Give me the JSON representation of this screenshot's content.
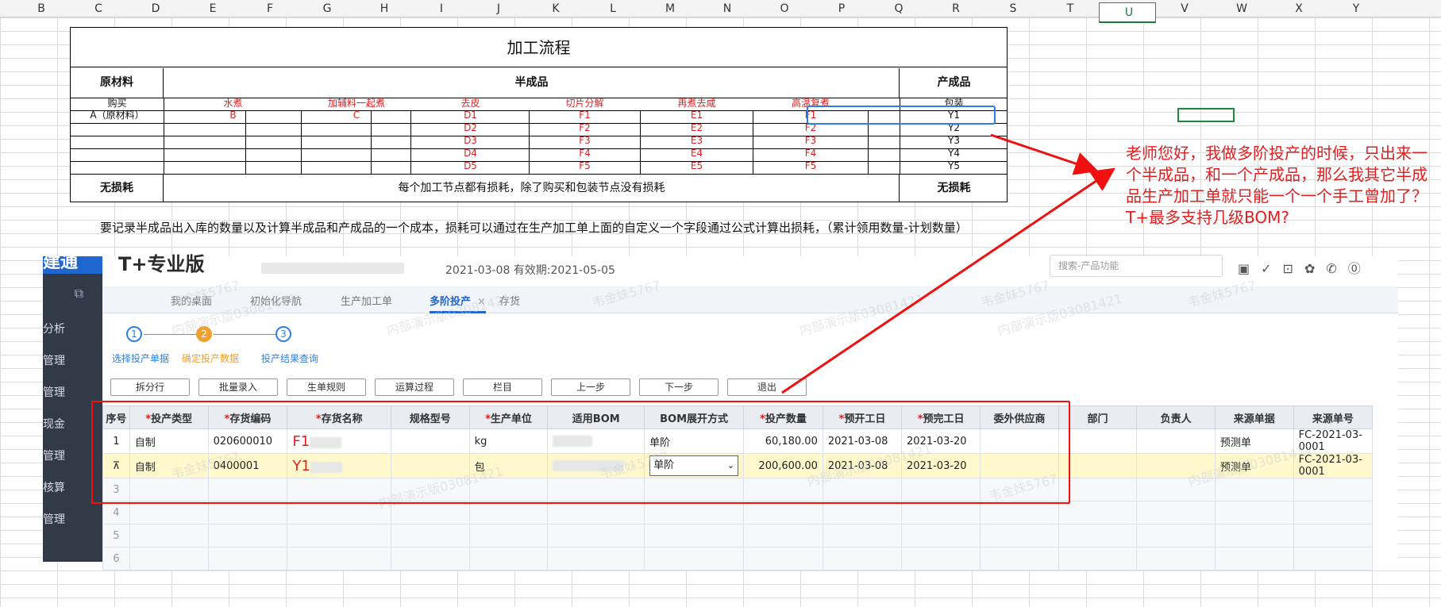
{
  "excel": {
    "columns": [
      "B",
      "C",
      "D",
      "E",
      "F",
      "G",
      "H",
      "I",
      "J",
      "K",
      "L",
      "M",
      "N",
      "O",
      "P",
      "Q",
      "R",
      "S",
      "T",
      "U",
      "V",
      "W",
      "X",
      "Y"
    ],
    "table": {
      "title": "加工流程",
      "headers": {
        "raw": "原材料",
        "semi": "半成品",
        "finished": "产成品"
      },
      "steps": [
        "购买",
        "水煮",
        "加辅料一起煮",
        "去皮",
        "切片分解",
        "再煮去咸",
        "高温复煮",
        "包装"
      ],
      "row1": [
        "A（原材料）",
        "B",
        "C",
        "D1",
        "F1",
        "E1",
        "F1",
        "Y1"
      ],
      "extra_rows": [
        {
          "d": "D2",
          "f": "F2",
          "e": "E2",
          "g": "F2",
          "y": "Y2"
        },
        {
          "d": "D3",
          "f": "F3",
          "e": "E3",
          "g": "F3",
          "y": "Y3"
        },
        {
          "d": "D4",
          "f": "F4",
          "e": "E4",
          "g": "F4",
          "y": "Y4"
        },
        {
          "d": "D5",
          "f": "F5",
          "e": "E5",
          "g": "F5",
          "y": "Y5"
        }
      ],
      "bottom": {
        "left": "无损耗",
        "mid": "每个加工节点都有损耗，除了购买和包装节点没有损耗",
        "right": "无损耗"
      }
    },
    "note": "要记录半成品出入库的数量以及计算半成品和产成品的一个成本，损耗可以通过在生产加工单上面的自定义一个字段通过公式计算出损耗，（累计领用数量-计划数量）"
  },
  "app": {
    "brand": "T+专业版",
    "date_info": "2021-03-08  有效期:2021-05-05",
    "search_placeholder": "搜索-产品功能",
    "sidebar": [
      "分析",
      "管理",
      "管理",
      "现金",
      "管理",
      "核算",
      "管理"
    ],
    "tabs": [
      "我的桌面",
      "初始化导航",
      "生产加工单",
      "多阶投产",
      "存货"
    ],
    "tab_close": "×",
    "steps": [
      {
        "n": "1",
        "label": "选择投产单据"
      },
      {
        "n": "2",
        "label": "确定投产数据"
      },
      {
        "n": "3",
        "label": "投产结果查询"
      }
    ],
    "buttons": [
      "拆分行",
      "批量录入",
      "生单规则",
      "运算过程",
      "栏目",
      "上一步",
      "下一步",
      "退出"
    ],
    "grid": {
      "headers": [
        "序号",
        "投产类型",
        "存货编码",
        "存货名称",
        "规格型号",
        "生产单位",
        "适用BOM",
        "BOM展开方式",
        "投产数量",
        "预开工日",
        "预完工日",
        "委外供应商",
        "部门",
        "负责人",
        "来源单据",
        "来源单号"
      ],
      "required": [
        false,
        true,
        true,
        true,
        false,
        true,
        false,
        false,
        true,
        true,
        true,
        false,
        false,
        false,
        false,
        false
      ],
      "rows": [
        {
          "no": "1",
          "type": "自制",
          "code": "020600010",
          "name": "F1",
          "unit": "kg",
          "expand": "单阶",
          "qty": "60,180.00",
          "start": "2021-03-08",
          "end": "2021-03-20",
          "src": "预测单",
          "srcno": "FC-2021-03-0001"
        },
        {
          "no": "⊼",
          "type": "自制",
          "code": "0400001",
          "name": "Y1",
          "unit": "包",
          "expand": "单阶",
          "qty": "200,600.00",
          "start": "2021-03-08",
          "end": "2021-03-20",
          "src": "预测单",
          "srcno": "FC-2021-03-0001"
        }
      ],
      "empty_rows": [
        "3",
        "4",
        "5",
        "6"
      ]
    },
    "watermarks": [
      "韦金妹5767",
      "内部演示版03081421"
    ]
  },
  "annotation": {
    "comment": "老师您好，我做多阶投产的时候，只出来一个半成品，和一个产成品，那么我其它半成品生产加工单就只能一个一个手工曾加了？T+最多支持几级BOM?"
  },
  "colors": {
    "red": "#e02020",
    "blue": "#2d7fe6",
    "orange": "#f0a030",
    "sidebar": "#323a48",
    "highlight": "#fff8cc"
  }
}
